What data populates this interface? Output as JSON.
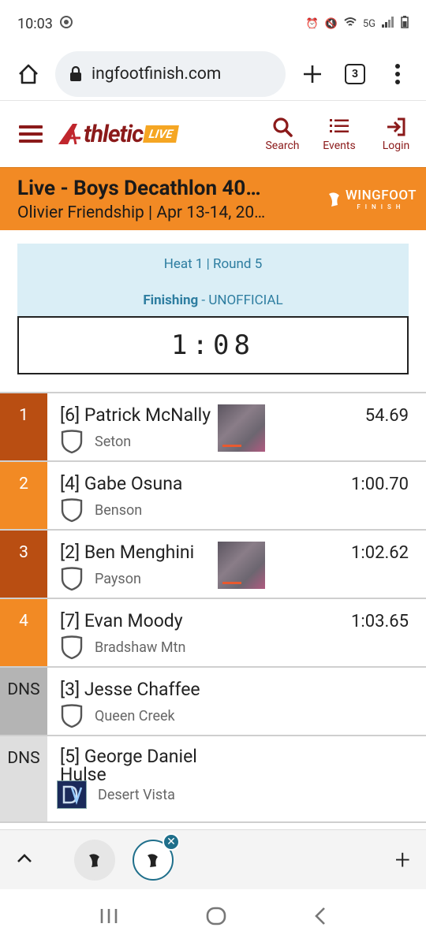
{
  "statusbar": {
    "time": "10:03",
    "network": "5G"
  },
  "browser": {
    "url": "ingfootfinish.com",
    "tab_count": "3"
  },
  "site": {
    "logo_main": "thletic",
    "logo_live": "LIVE",
    "nav": [
      {
        "label": "Search",
        "icon": "search-icon"
      },
      {
        "label": "Events",
        "icon": "list-icon"
      },
      {
        "label": "Login",
        "icon": "login-icon"
      }
    ]
  },
  "event": {
    "title": "Live - Boys Decathlon 40…",
    "subtitle": "Olivier Friendship | Apr 13-14, 20…",
    "brand": "WINGFOOT",
    "brand_sub": "FINISH"
  },
  "heat": {
    "label": "Heat 1 | Round 5",
    "status_bold": "Finishing",
    "status_rest": " - UNOFFICIAL",
    "clock": "1:08"
  },
  "results": [
    {
      "place": "1",
      "name": "[6] Patrick McNally",
      "team": "Seton",
      "time": "54.69"
    },
    {
      "place": "2",
      "name": "[4] Gabe Osuna",
      "team": "Benson",
      "time": "1:00.70"
    },
    {
      "place": "3",
      "name": "[2] Ben Menghini",
      "team": "Payson",
      "time": "1:02.62"
    },
    {
      "place": "4",
      "name": "[7] Evan Moody",
      "team": "Bradshaw Mtn",
      "time": "1:03.65"
    },
    {
      "place": "DNS",
      "name": "[3] Jesse Chaffee",
      "team": "Queen Creek",
      "time": ""
    },
    {
      "place": "DNS",
      "name_line1": "[5] George Daniel",
      "name_line2": "Hulse",
      "team": "Desert Vista",
      "time": ""
    }
  ],
  "colors": {
    "accent_orange": "#f28a24",
    "dark_orange": "#b94e12",
    "brand_maroon": "#8b1a1a",
    "heat_panel": "#daeef6"
  }
}
